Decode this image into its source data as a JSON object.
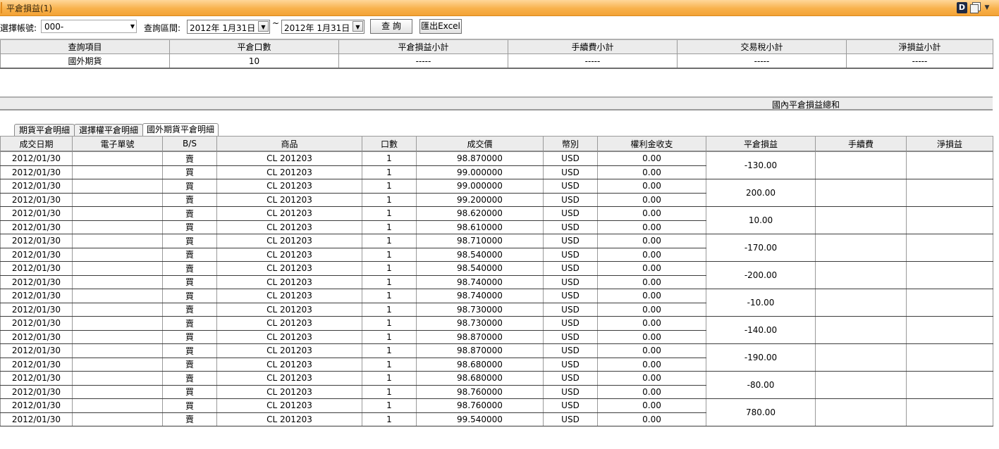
{
  "window": {
    "title": "平倉損益(1)",
    "d_label": "D"
  },
  "toolbar": {
    "account_label": "選擇帳號:",
    "account_value": "000-",
    "range_label": "查詢區間:",
    "date_from": "2012年  1月31日",
    "tilde": "~",
    "date_to": "2012年  1月31日",
    "query_button": "查 詢",
    "export_button": "匯出Excel"
  },
  "summary": {
    "headers": [
      "查詢項目",
      "平倉口數",
      "平倉損益小計",
      "手續費小計",
      "交易稅小計",
      "淨損益小計"
    ],
    "row": [
      "國外期貨",
      "10",
      "-----",
      "-----",
      "-----",
      "-----"
    ]
  },
  "total_label": "國內平倉損益總和",
  "tabs": [
    "期貨平倉明細",
    "選擇權平倉明細",
    "國外期貨平倉明細"
  ],
  "detail": {
    "headers": [
      "成交日期",
      "電子單號",
      "B/S",
      "商品",
      "口數",
      "成交價",
      "幣別",
      "權利金收支",
      "平倉損益",
      "手續費",
      "淨損益"
    ],
    "rows": [
      {
        "date": "2012/01/30",
        "order": "",
        "bs": "賣",
        "product": "CL 201203",
        "qty": "1",
        "price": "98.870000",
        "ccy": "USD",
        "premium": "0.00"
      },
      {
        "date": "2012/01/30",
        "order": "",
        "bs": "買",
        "product": "CL 201203",
        "qty": "1",
        "price": "99.000000",
        "ccy": "USD",
        "premium": "0.00"
      },
      {
        "date": "2012/01/30",
        "order": "",
        "bs": "買",
        "product": "CL 201203",
        "qty": "1",
        "price": "99.000000",
        "ccy": "USD",
        "premium": "0.00"
      },
      {
        "date": "2012/01/30",
        "order": "",
        "bs": "賣",
        "product": "CL 201203",
        "qty": "1",
        "price": "99.200000",
        "ccy": "USD",
        "premium": "0.00"
      },
      {
        "date": "2012/01/30",
        "order": "",
        "bs": "賣",
        "product": "CL 201203",
        "qty": "1",
        "price": "98.620000",
        "ccy": "USD",
        "premium": "0.00"
      },
      {
        "date": "2012/01/30",
        "order": "",
        "bs": "買",
        "product": "CL 201203",
        "qty": "1",
        "price": "98.610000",
        "ccy": "USD",
        "premium": "0.00"
      },
      {
        "date": "2012/01/30",
        "order": "",
        "bs": "買",
        "product": "CL 201203",
        "qty": "1",
        "price": "98.710000",
        "ccy": "USD",
        "premium": "0.00"
      },
      {
        "date": "2012/01/30",
        "order": "",
        "bs": "賣",
        "product": "CL 201203",
        "qty": "1",
        "price": "98.540000",
        "ccy": "USD",
        "premium": "0.00"
      },
      {
        "date": "2012/01/30",
        "order": "",
        "bs": "賣",
        "product": "CL 201203",
        "qty": "1",
        "price": "98.540000",
        "ccy": "USD",
        "premium": "0.00"
      },
      {
        "date": "2012/01/30",
        "order": "",
        "bs": "買",
        "product": "CL 201203",
        "qty": "1",
        "price": "98.740000",
        "ccy": "USD",
        "premium": "0.00"
      },
      {
        "date": "2012/01/30",
        "order": "",
        "bs": "買",
        "product": "CL 201203",
        "qty": "1",
        "price": "98.740000",
        "ccy": "USD",
        "premium": "0.00"
      },
      {
        "date": "2012/01/30",
        "order": "",
        "bs": "賣",
        "product": "CL 201203",
        "qty": "1",
        "price": "98.730000",
        "ccy": "USD",
        "premium": "0.00"
      },
      {
        "date": "2012/01/30",
        "order": "",
        "bs": "賣",
        "product": "CL 201203",
        "qty": "1",
        "price": "98.730000",
        "ccy": "USD",
        "premium": "0.00"
      },
      {
        "date": "2012/01/30",
        "order": "",
        "bs": "買",
        "product": "CL 201203",
        "qty": "1",
        "price": "98.870000",
        "ccy": "USD",
        "premium": "0.00"
      },
      {
        "date": "2012/01/30",
        "order": "",
        "bs": "買",
        "product": "CL 201203",
        "qty": "1",
        "price": "98.870000",
        "ccy": "USD",
        "premium": "0.00"
      },
      {
        "date": "2012/01/30",
        "order": "",
        "bs": "賣",
        "product": "CL 201203",
        "qty": "1",
        "price": "98.680000",
        "ccy": "USD",
        "premium": "0.00"
      },
      {
        "date": "2012/01/30",
        "order": "",
        "bs": "賣",
        "product": "CL 201203",
        "qty": "1",
        "price": "98.680000",
        "ccy": "USD",
        "premium": "0.00"
      },
      {
        "date": "2012/01/30",
        "order": "",
        "bs": "買",
        "product": "CL 201203",
        "qty": "1",
        "price": "98.760000",
        "ccy": "USD",
        "premium": "0.00"
      },
      {
        "date": "2012/01/30",
        "order": "",
        "bs": "買",
        "product": "CL 201203",
        "qty": "1",
        "price": "98.760000",
        "ccy": "USD",
        "premium": "0.00"
      },
      {
        "date": "2012/01/30",
        "order": "",
        "bs": "賣",
        "product": "CL 201203",
        "qty": "1",
        "price": "99.540000",
        "ccy": "USD",
        "premium": "0.00"
      }
    ],
    "pairs": [
      {
        "pl": "-130.00",
        "fee": "",
        "net": ""
      },
      {
        "pl": "200.00",
        "fee": "",
        "net": ""
      },
      {
        "pl": "10.00",
        "fee": "",
        "net": ""
      },
      {
        "pl": "-170.00",
        "fee": "",
        "net": ""
      },
      {
        "pl": "-200.00",
        "fee": "",
        "net": ""
      },
      {
        "pl": "-10.00",
        "fee": "",
        "net": ""
      },
      {
        "pl": "-140.00",
        "fee": "",
        "net": ""
      },
      {
        "pl": "-190.00",
        "fee": "",
        "net": ""
      },
      {
        "pl": "-80.00",
        "fee": "",
        "net": ""
      },
      {
        "pl": "780.00",
        "fee": "",
        "net": ""
      }
    ]
  }
}
